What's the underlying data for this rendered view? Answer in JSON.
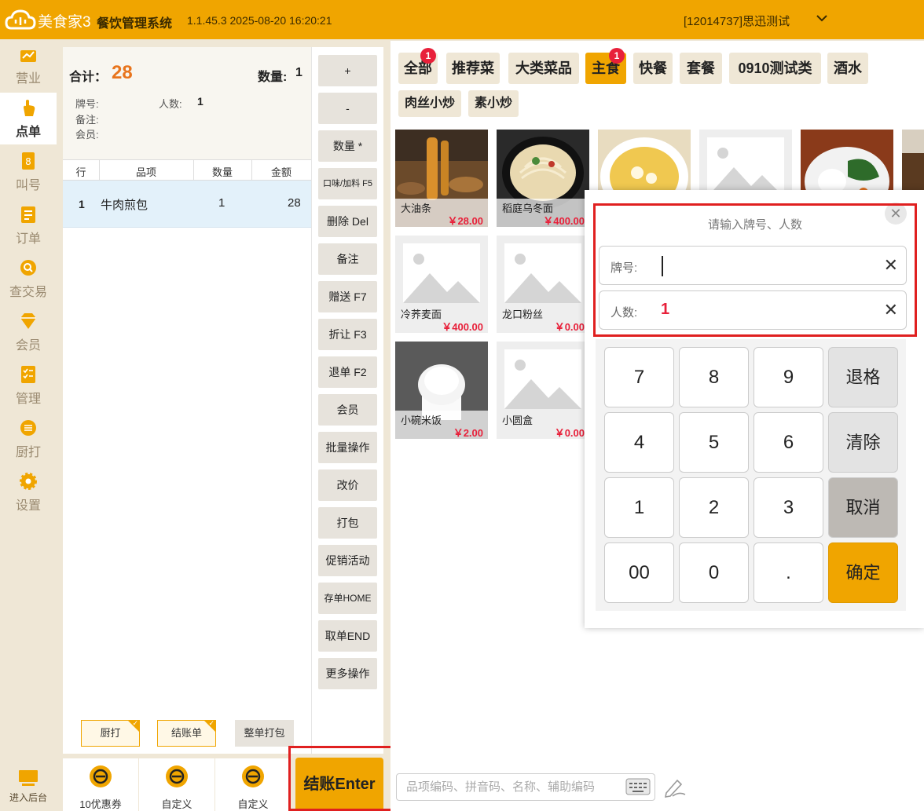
{
  "header": {
    "brand": "美食家3",
    "system_name": "餐饮管理系统",
    "version": "1.1.45.3 2025-08-20 16:20:21",
    "user": "[12014737]思迅测试"
  },
  "nav": {
    "items": [
      {
        "label": "营业",
        "icon": "business-icon"
      },
      {
        "label": "点单",
        "icon": "order-hand-icon",
        "active": true
      },
      {
        "label": "叫号",
        "icon": "call-number-icon"
      },
      {
        "label": "订单",
        "icon": "orders-icon"
      },
      {
        "label": "查交易",
        "icon": "search-transaction-icon"
      },
      {
        "label": "会员",
        "icon": "member-diamond-icon"
      },
      {
        "label": "管理",
        "icon": "manage-checklist-icon"
      },
      {
        "label": "厨打",
        "icon": "kitchen-print-icon"
      },
      {
        "label": "设置",
        "icon": "settings-gear-icon"
      }
    ],
    "backend": "进入后台"
  },
  "order": {
    "total_label": "合计：",
    "total_value": "28",
    "qty_label": "数量:",
    "qty_value": "1",
    "tag_label": "牌号:",
    "people_label": "人数:",
    "people_value": "1",
    "remark_label": "备注:",
    "member_label": "会员:",
    "columns": [
      "行",
      "品项",
      "数量",
      "金额"
    ],
    "rows": [
      {
        "line": "1",
        "item": "牛肉煎包",
        "qty": "1",
        "amount": "28"
      }
    ],
    "kitchen_print": "厨打",
    "bill": "结账单",
    "whole_pack": "整单打包"
  },
  "bottom": {
    "tiles": [
      {
        "label": "10优惠券"
      },
      {
        "label": "自定义"
      },
      {
        "label": "自定义"
      }
    ],
    "checkout": "结账Enter"
  },
  "actions": [
    "+",
    "-",
    "数量 *",
    "口味/加料 F5",
    "删除 Del",
    "备注",
    "赠送 F7",
    "折让 F3",
    "退单 F2",
    "会员",
    "批量操作",
    "改价",
    "打包",
    "促销活动",
    "存单HOME",
    "取单END",
    "更多操作"
  ],
  "categories": [
    {
      "label": "全部",
      "badge": "1"
    },
    {
      "label": "推荐菜"
    },
    {
      "label": "大类菜品"
    },
    {
      "label": "主食",
      "badge": "1",
      "active": true
    },
    {
      "label": "快餐"
    },
    {
      "label": "套餐"
    },
    {
      "label": "0910测试类"
    },
    {
      "label": "酒水"
    },
    {
      "label": "肉丝小炒"
    },
    {
      "label": "素小炒"
    }
  ],
  "dishes": [
    {
      "name": "大油条",
      "price": "￥28.00"
    },
    {
      "name": "稻庭乌冬面",
      "price": "￥400.00"
    },
    {
      "name": "冷荞麦面",
      "price": "￥400.00"
    },
    {
      "name": "龙口粉丝",
      "price": "￥0.00"
    },
    {
      "name": "小碗米饭",
      "price": "￥2.00"
    },
    {
      "name": "小圆盒",
      "price": "￥0.00"
    }
  ],
  "search": {
    "placeholder": "品项编码、拼音码、名称、辅助编码"
  },
  "dialog": {
    "title": "请输入牌号、人数",
    "tag_label": "牌号:",
    "tag_value": "",
    "people_label": "人数:",
    "people_value": "1",
    "keys": [
      "7",
      "8",
      "9",
      "退格",
      "4",
      "5",
      "6",
      "清除",
      "1",
      "2",
      "3",
      "取消",
      "00",
      "0",
      ".",
      "确定"
    ]
  },
  "colors": {
    "brand": "#f0a500",
    "accent_red": "#e8203a",
    "highlight_frame": "#e02020",
    "total": "#e8741c"
  }
}
